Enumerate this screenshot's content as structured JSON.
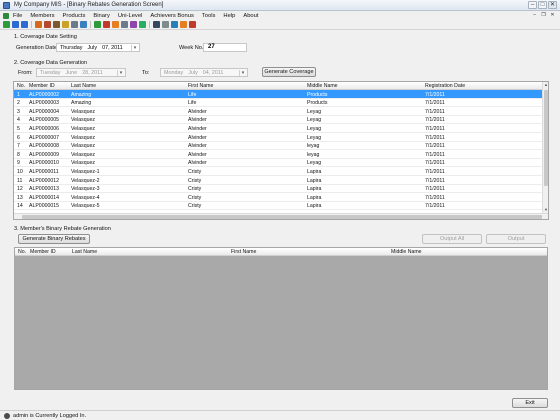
{
  "window": {
    "title": "My Company MIS - [Binary Rebates Generation Screen]"
  },
  "menu": {
    "items": [
      "File",
      "Members",
      "Products",
      "Binary",
      "Uni-Level",
      "Achievers Bonus",
      "Tools",
      "Help",
      "About"
    ]
  },
  "toolbar": {
    "icons": [
      {
        "name": "add-icon",
        "color": "#2e9b3b"
      },
      {
        "name": "back-icon",
        "color": "#2c6bd1"
      },
      {
        "name": "save-icon",
        "color": "#2c6bd1"
      },
      {
        "name": "products-icon",
        "color": "#d46a1a"
      },
      {
        "name": "members-icon",
        "color": "#b34a2f"
      },
      {
        "name": "orders-icon",
        "color": "#7a5a2f"
      },
      {
        "name": "cart-icon",
        "color": "#c9a227"
      },
      {
        "name": "report-icon",
        "color": "#6c7a89"
      },
      {
        "name": "network-icon",
        "color": "#3a7fc1"
      },
      {
        "name": "chart-icon",
        "color": "#2e9b3b"
      },
      {
        "name": "binary-icon",
        "color": "#c0392b"
      },
      {
        "name": "calendar-icon",
        "color": "#e67e22"
      },
      {
        "name": "settings-icon",
        "color": "#6c7a89"
      },
      {
        "name": "rebates-icon",
        "color": "#8e44ad"
      },
      {
        "name": "tree-icon",
        "color": "#27ae60"
      },
      {
        "name": "print-icon",
        "color": "#34495e"
      },
      {
        "name": "tools-icon",
        "color": "#7f8c8d"
      },
      {
        "name": "user-icon",
        "color": "#2980b9"
      },
      {
        "name": "lock-icon",
        "color": "#e67e22"
      },
      {
        "name": "exit-icon",
        "color": "#c0392b"
      }
    ]
  },
  "coverage_setting": {
    "title": "1. Coverage Date Setting",
    "gen_date_label": "Generation Date:",
    "gen_date": {
      "day": "Thursday",
      "month": "July",
      "date": "07, 2011"
    },
    "week_label": "Week No.:",
    "week_no": "27"
  },
  "coverage_generation": {
    "title": "2. Coverage Data Generation",
    "from_label": "From:",
    "from_date": {
      "day": "Tuesday",
      "month": "June",
      "date": "28, 2011"
    },
    "to_label": "To:",
    "to_date": {
      "day": "Monday",
      "month": "July",
      "date": "04, 2011"
    },
    "button": "Generate Coverage"
  },
  "coverage_grid": {
    "columns": [
      "No.",
      "Member ID",
      "Last Name",
      "First Name",
      "Middle Name",
      "Registration Date"
    ],
    "selected_index": 0,
    "rows": [
      [
        "1",
        "ALP0000002",
        "Amazing",
        "Life",
        "Products",
        "7/1/2011"
      ],
      [
        "2",
        "ALP0000003",
        "Amazing",
        "Life",
        "Products",
        "7/1/2011"
      ],
      [
        "3",
        "ALP0000004",
        "Velasquez",
        "Alvinder",
        "Leyag",
        "7/1/2011"
      ],
      [
        "4",
        "ALP0000005",
        "Velasquez",
        "Alvinder",
        "Leyag",
        "7/1/2011"
      ],
      [
        "5",
        "ALP0000006",
        "Velasquez",
        "Alvinder",
        "Leyag",
        "7/1/2011"
      ],
      [
        "6",
        "ALP0000007",
        "Velasquez",
        "Alvinder",
        "Leyag",
        "7/1/2011"
      ],
      [
        "7",
        "ALP0000008",
        "Velasquez",
        "Alvinder",
        "leyag",
        "7/1/2011"
      ],
      [
        "8",
        "ALP0000009",
        "Velasquez",
        "Alvinder",
        "leyag",
        "7/1/2011"
      ],
      [
        "9",
        "ALP0000010",
        "Velasquez",
        "Alvinder",
        "Leyag",
        "7/1/2011"
      ],
      [
        "10",
        "ALP0000011",
        "Velasquez-1",
        "Cristy",
        "Lapira",
        "7/1/2011"
      ],
      [
        "11",
        "ALP0000012",
        "Velasquez-2",
        "Cristy",
        "Lapira",
        "7/1/2011"
      ],
      [
        "12",
        "ALP0000013",
        "Velasquez-3",
        "Cristy",
        "Lapira",
        "7/1/2011"
      ],
      [
        "13",
        "ALP0000014",
        "Velasquez-4",
        "Cristy",
        "Lapira",
        "7/1/2011"
      ],
      [
        "14",
        "ALP0000015",
        "Velasquez-5",
        "Cristy",
        "Lapira",
        "7/1/2011"
      ]
    ]
  },
  "binary_generation": {
    "title": "3. Member's Binary Rebate Generation",
    "button": "Generate Binary Rebates",
    "output_all": "Output All",
    "output": "Output"
  },
  "rebate_grid": {
    "columns": [
      "No.",
      "Member ID",
      "Last Name",
      "First Name",
      "Middle Name"
    ]
  },
  "exit_button": "Exit",
  "status": {
    "text": "admin is Currently Logged In."
  }
}
